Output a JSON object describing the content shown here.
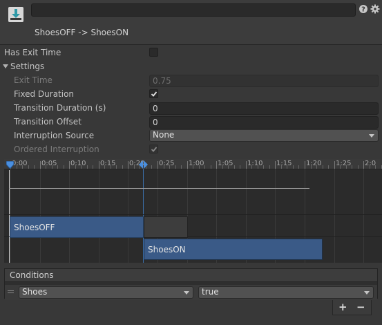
{
  "header": {
    "transition_name": "",
    "title": "ShoesOFF -> ShoesON",
    "icons": {
      "transition": "transition-download-icon",
      "help": "help-icon",
      "settings": "gear-icon"
    }
  },
  "has_exit_time": {
    "label": "Has Exit Time",
    "checked": false
  },
  "settings": {
    "label": "Settings",
    "exit_time": {
      "label": "Exit Time",
      "value": "0.75"
    },
    "fixed_duration": {
      "label": "Fixed Duration",
      "checked": true
    },
    "transition_duration": {
      "label": "Transition Duration (s)",
      "value": "0"
    },
    "transition_offset": {
      "label": "Transition Offset",
      "value": "0"
    },
    "interruption_source": {
      "label": "Interruption Source",
      "value": "None"
    },
    "ordered_interruption": {
      "label": "Ordered Interruption",
      "checked": true
    }
  },
  "timeline": {
    "ticks": [
      "0:00",
      "0:05",
      "0:10",
      "0:15",
      "0:20",
      "0:25",
      "1:00",
      "1:05",
      "1:10",
      "1:15",
      "1:20",
      "1:25",
      "2:0"
    ],
    "clips": [
      {
        "label": "ShoesOFF"
      },
      {
        "label": "ShoesON"
      }
    ]
  },
  "conditions": {
    "label": "Conditions",
    "rows": [
      {
        "parameter": "Shoes",
        "value": "true"
      }
    ],
    "add_label": "+",
    "remove_label": "−"
  },
  "colors": {
    "background": "#383838",
    "clip_blue": "#3a5a87",
    "clip_gray": "#3d3d3d",
    "marker_blue": "#3b7bd4"
  }
}
